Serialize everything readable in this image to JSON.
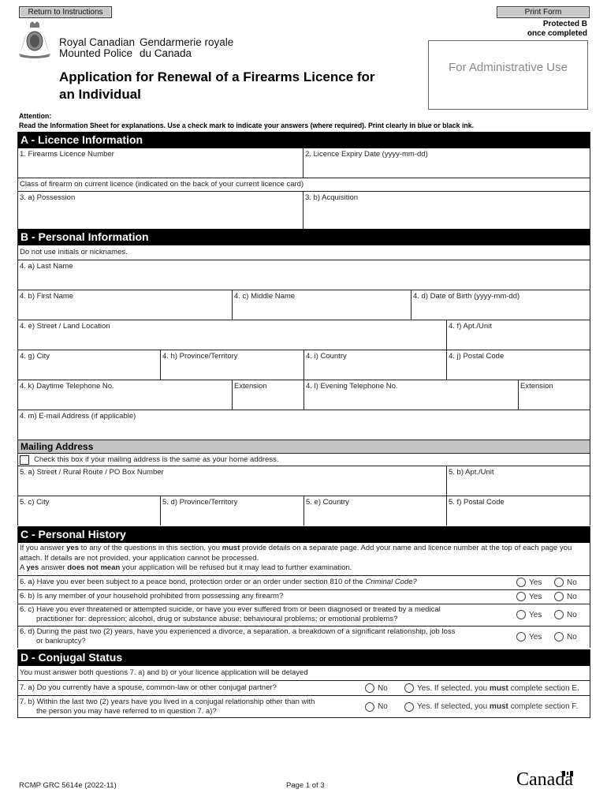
{
  "header": {
    "return_button": "Return to Instructions",
    "print_button": "Print Form",
    "org_en_line1": "Royal Canadian",
    "org_en_line2": "Mounted Police",
    "org_fr_line1": "Gendarmerie royale",
    "org_fr_line2": "du Canada",
    "title_line1": "Application for Renewal of a Firearms Licence for",
    "title_line2": "an Individual",
    "protected_line1": "Protected B",
    "protected_line2": "once completed",
    "admin_box": "For Administrative Use",
    "attention_label": "Attention:",
    "attention_text": "Read the Information Sheet for explanations. Use a check mark to indicate your answers (where required). Print clearly in blue or black ink."
  },
  "section_a": {
    "title": "A - Licence Information",
    "licence_number": "1. Firearms Licence Number",
    "expiry_date": "2. Licence Expiry Date (yyyy-mm-dd)",
    "class_note": "Class of firearm on current licence (indicated on the back of your current licence card)",
    "possession": "3. a) Possession",
    "acquisition": "3. b) Acquisition"
  },
  "section_b": {
    "title": "B - Personal Information",
    "note": "Do not use initials or nicknames.",
    "last_name": "4. a) Last Name",
    "first_name": "4. b) First Name",
    "middle_name": "4. c) Middle Name",
    "dob": "4. d) Date of Birth (yyyy-mm-dd)",
    "street": "4. e) Street / Land Location",
    "apt": "4. f) Apt./Unit",
    "city": "4. g) City",
    "province": "4. h) Province/Territory",
    "country": "4. i) Country",
    "postal": "4. j) Postal Code",
    "day_phone": "4. k) Daytime Telephone No.",
    "day_ext": "Extension",
    "eve_phone": "4. l) Evening Telephone No.",
    "eve_ext": "Extension",
    "email": "4. m) E-mail Address (if applicable)"
  },
  "mailing": {
    "title": "Mailing Address",
    "same_checkbox": "Check this box if your mailing address is the same as your home address.",
    "street": "5. a) Street / Rural Route / PO Box Number",
    "apt": "5. b) Apt./Unit",
    "city": "5. c) City",
    "province": "5. d) Province/Territory",
    "country": "5. e) Country",
    "postal": "5. f) Postal Code"
  },
  "section_c": {
    "title": "C - Personal History",
    "intro_1a": "If you answer ",
    "intro_1b": "yes",
    "intro_1c": " to any of the questions in this section, you ",
    "intro_1d": "must",
    "intro_1e": " provide details on a separate page. Add your name and licence number at the top of each page you attach. If details are not provided, your application cannot be processed.",
    "intro_2a": "A ",
    "intro_2b": "yes",
    "intro_2c": " answer ",
    "intro_2d": "does not mean",
    "intro_2e": " your application will be refused but it may lead to further examination.",
    "yes_label": "Yes",
    "no_label": "No",
    "q6a_text": "6. a) Have you ever been subject to a peace bond, protection order or an order under section 810 of the ",
    "q6a_italic": "Criminal Code?",
    "q6b": "6. b) Is any member of your household prohibited from possessing any firearm?",
    "q6c_line1": "6. c) Have you ever threatened or attempted suicide, or have you ever suffered from or been diagnosed or treated by a medical",
    "q6c_line2": "practitioner for: depression; alcohol, drug or substance abuse; behavioural problems; or emotional problems?",
    "q6d_line1": "6. d) During the past two (2) years, have you experienced a divorce, a separation, a breakdown of a significant relationship, job loss",
    "q6d_line2": "or bankruptcy?"
  },
  "section_d": {
    "title": "D - Conjugal Status",
    "note": "You must answer both questions 7. a) and b) or your licence application will be delayed",
    "no_label": "No",
    "q7a": "7. a) Do you currently have a spouse, common-law or other conjugal partner?",
    "q7a_yes_a": "Yes. If selected, you ",
    "q7a_yes_b": "must",
    "q7a_yes_c": " complete section E.",
    "q7b_line1": "7. b) Within the last two (2) years have you lived in a conjugal relationship other than with",
    "q7b_line2": "the person you may have referred to in question 7. a)?",
    "q7b_yes_a": "Yes. If selected, you ",
    "q7b_yes_b": "must",
    "q7b_yes_c": " complete section F."
  },
  "footer": {
    "form_id": "RCMP GRC 5614e (2022-11)",
    "page": "Page 1 of 3",
    "wordmark": "Canada"
  }
}
